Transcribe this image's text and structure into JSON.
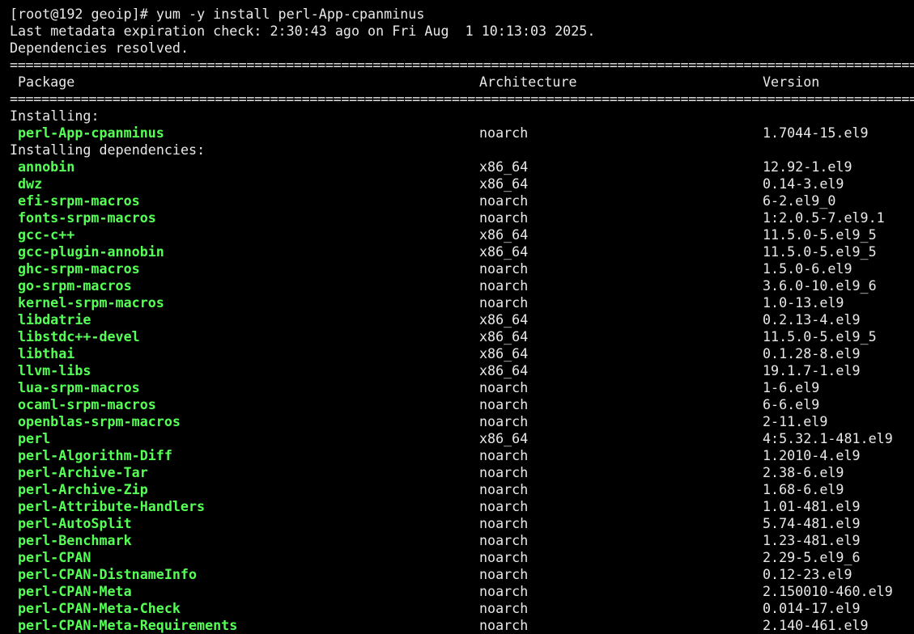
{
  "terminal": {
    "prompt_line": "[root@192 geoip]# yum -y install perl-App-cpanminus",
    "metadata_line": "Last metadata expiration check: 2:30:43 ago on Fri Aug  1 10:13:03 2025.",
    "deps_line": "Dependencies resolved.",
    "separator": "===========================================================================================================================================================",
    "headers": {
      "package": "Package",
      "architecture": "Architecture",
      "version": "Version"
    },
    "installing_label": "Installing:",
    "installing": [
      {
        "name": "perl-App-cpanminus",
        "arch": "noarch",
        "version": "1.7044-15.el9"
      }
    ],
    "installing_deps_label": "Installing dependencies:",
    "dependencies": [
      {
        "name": "annobin",
        "arch": "x86_64",
        "version": "12.92-1.el9"
      },
      {
        "name": "dwz",
        "arch": "x86_64",
        "version": "0.14-3.el9"
      },
      {
        "name": "efi-srpm-macros",
        "arch": "noarch",
        "version": "6-2.el9_0"
      },
      {
        "name": "fonts-srpm-macros",
        "arch": "noarch",
        "version": "1:2.0.5-7.el9.1"
      },
      {
        "name": "gcc-c++",
        "arch": "x86_64",
        "version": "11.5.0-5.el9_5"
      },
      {
        "name": "gcc-plugin-annobin",
        "arch": "x86_64",
        "version": "11.5.0-5.el9_5"
      },
      {
        "name": "ghc-srpm-macros",
        "arch": "noarch",
        "version": "1.5.0-6.el9"
      },
      {
        "name": "go-srpm-macros",
        "arch": "noarch",
        "version": "3.6.0-10.el9_6"
      },
      {
        "name": "kernel-srpm-macros",
        "arch": "noarch",
        "version": "1.0-13.el9"
      },
      {
        "name": "libdatrie",
        "arch": "x86_64",
        "version": "0.2.13-4.el9"
      },
      {
        "name": "libstdc++-devel",
        "arch": "x86_64",
        "version": "11.5.0-5.el9_5"
      },
      {
        "name": "libthai",
        "arch": "x86_64",
        "version": "0.1.28-8.el9"
      },
      {
        "name": "llvm-libs",
        "arch": "x86_64",
        "version": "19.1.7-1.el9"
      },
      {
        "name": "lua-srpm-macros",
        "arch": "noarch",
        "version": "1-6.el9"
      },
      {
        "name": "ocaml-srpm-macros",
        "arch": "noarch",
        "version": "6-6.el9"
      },
      {
        "name": "openblas-srpm-macros",
        "arch": "noarch",
        "version": "2-11.el9"
      },
      {
        "name": "perl",
        "arch": "x86_64",
        "version": "4:5.32.1-481.el9"
      },
      {
        "name": "perl-Algorithm-Diff",
        "arch": "noarch",
        "version": "1.2010-4.el9"
      },
      {
        "name": "perl-Archive-Tar",
        "arch": "noarch",
        "version": "2.38-6.el9"
      },
      {
        "name": "perl-Archive-Zip",
        "arch": "noarch",
        "version": "1.68-6.el9"
      },
      {
        "name": "perl-Attribute-Handlers",
        "arch": "noarch",
        "version": "1.01-481.el9"
      },
      {
        "name": "perl-AutoSplit",
        "arch": "noarch",
        "version": "5.74-481.el9"
      },
      {
        "name": "perl-Benchmark",
        "arch": "noarch",
        "version": "1.23-481.el9"
      },
      {
        "name": "perl-CPAN",
        "arch": "noarch",
        "version": "2.29-5.el9_6"
      },
      {
        "name": "perl-CPAN-DistnameInfo",
        "arch": "noarch",
        "version": "0.12-23.el9"
      },
      {
        "name": "perl-CPAN-Meta",
        "arch": "noarch",
        "version": "2.150010-460.el9"
      },
      {
        "name": "perl-CPAN-Meta-Check",
        "arch": "noarch",
        "version": "0.014-17.el9"
      },
      {
        "name": "perl-CPAN-Meta-Requirements",
        "arch": "noarch",
        "version": "2.140-461.el9"
      }
    ]
  },
  "colors": {
    "background": "#000000",
    "text": "#e8e8e8",
    "package_name": "#55ff55"
  }
}
